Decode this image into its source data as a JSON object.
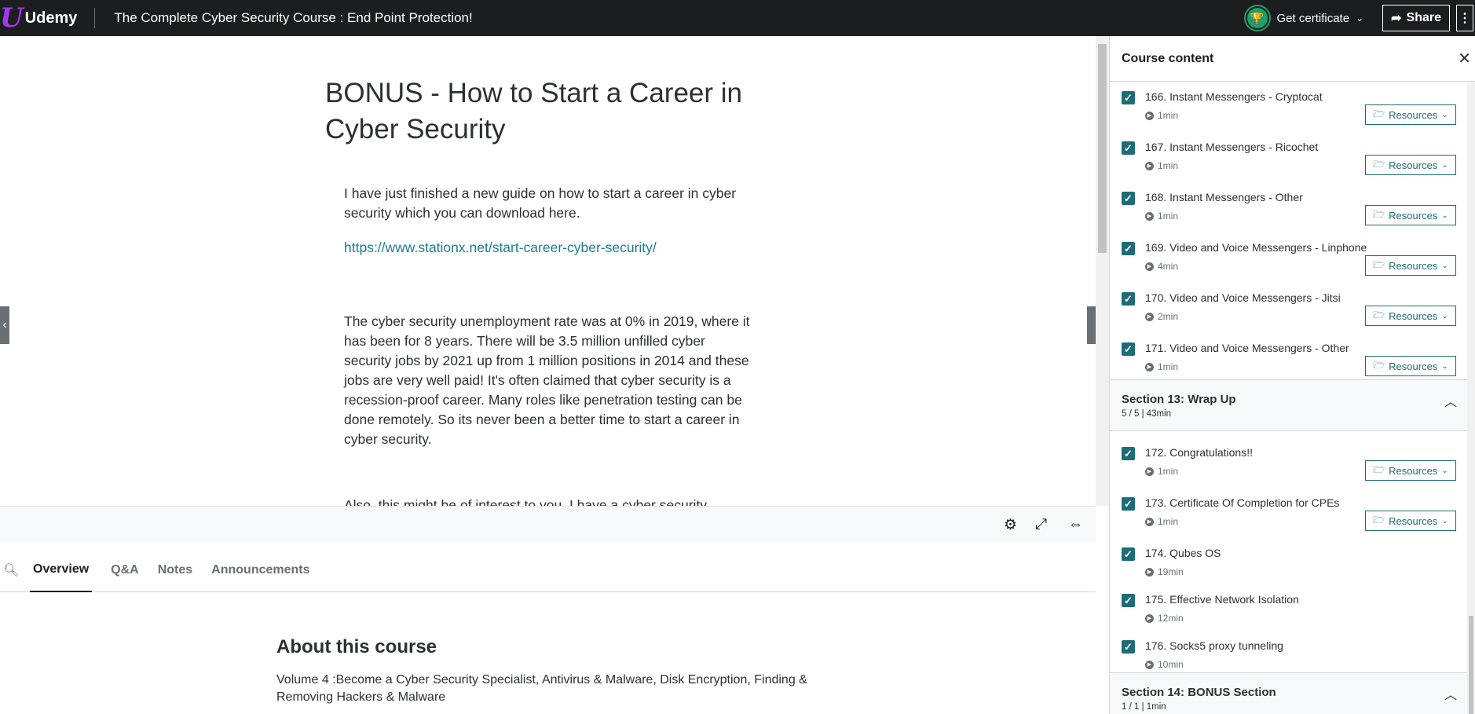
{
  "header": {
    "logo_mark": "U",
    "logo_text": "Udemy",
    "course_title": "The Complete Cyber Security Course : End Point Protection!",
    "certificate_label": "Get certificate",
    "share_label": "Share",
    "accent": "#1e9e6a"
  },
  "lecture": {
    "title": "BONUS - How to Start a Career in Cyber Security",
    "intro": "I have just finished a new guide on how to start a career in cyber security which you can download here.",
    "link": "https://www.stationx.net/start-career-cyber-security/",
    "body": "The cyber security unemployment rate was at 0% in 2019, where it has been for 8 years. There will be 3.5 million unfilled cyber security jobs by 2021 up from 1 million positions in 2014 and these jobs are very well paid! It's often claimed that cyber security is a recession-proof career. Many roles like penetration testing can be done remotely. So its never been a better time to start a career in cyber security.",
    "cutoff": "Also, this might be of interest to you. I have a cyber security"
  },
  "tabs": [
    {
      "label": "Overview",
      "active": true
    },
    {
      "label": "Q&A"
    },
    {
      "label": "Notes"
    },
    {
      "label": "Announcements"
    }
  ],
  "about": {
    "title": "About this course",
    "description": "Volume 4 :Become a Cyber Security Specialist, Antivirus & Malware, Disk Encryption, Finding & Removing Hackers & Malware"
  },
  "sidebar": {
    "title": "Course content",
    "resources_label": "Resources",
    "items_a": [
      {
        "label": "166. Instant Messengers - Cryptocat",
        "duration": "1min"
      },
      {
        "label": "167. Instant Messengers - Ricochet",
        "duration": "1min"
      },
      {
        "label": "168. Instant Messengers - Other",
        "duration": "1min"
      },
      {
        "label": "169. Video and Voice Messengers - Linphone",
        "duration": "4min"
      },
      {
        "label": "170. Video and Voice Messengers - Jitsi",
        "duration": "2min"
      },
      {
        "label": "171. Video and Voice Messengers - Other",
        "duration": "1min"
      }
    ],
    "section13": {
      "title": "Section 13: Wrap Up",
      "meta": "5 / 5 | 43min"
    },
    "items_b": [
      {
        "label": "172. Congratulations!!",
        "duration": "1min"
      },
      {
        "label": "173. Certificate Of Completion for CPEs",
        "duration": "1min"
      },
      {
        "label": "174. Qubes OS",
        "duration": "19min"
      },
      {
        "label": "175. Effective Network Isolation",
        "duration": "12min"
      },
      {
        "label": "176. Socks5 proxy tunneling",
        "duration": "10min"
      }
    ],
    "section14": {
      "title": "Section 14: BONUS Section",
      "meta": "1 / 1 | 1min"
    }
  }
}
